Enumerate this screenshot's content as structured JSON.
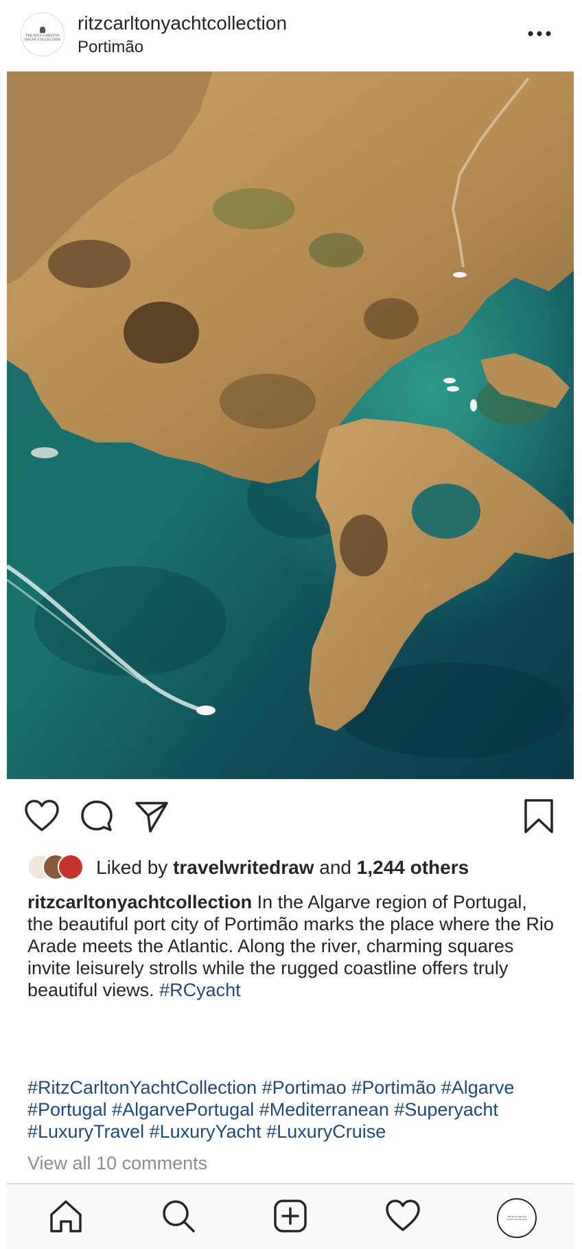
{
  "post": {
    "username": "ritzcarltonyachtcollection",
    "location": "Portimão",
    "likes": {
      "prefix": "Liked by",
      "liker": "travelwritedraw",
      "middle": "and",
      "count": "1,244 others"
    },
    "caption": {
      "author": "ritzcarltonyachtcollection",
      "text": "In the Algarve region of Portugal, the beautiful port city of Portimão marks the place where the Rio Arade meets the Atlantic. Along the river, charming squares invite leisurely strolls while the rugged coastline offers truly beautiful views.",
      "tag": "#RCyacht"
    },
    "hashtags": "#RitzCarltonYachtCollection #Portimao #Portimão #Algarve #Portugal #AlgarvePortugal #Mediterranean #Superyacht #LuxuryTravel #LuxuryYacht #LuxuryCruise",
    "comments_link": "View all 10 comments"
  },
  "logo": {
    "line1": "THE RITZ-CARLTON",
    "line2": "YACHT COLLECTION"
  },
  "icons": {
    "more": "more-horizontal-icon",
    "like": "heart-icon",
    "comment": "comment-icon",
    "share": "paper-plane-icon",
    "save": "bookmark-icon",
    "home": "home-icon",
    "search": "search-icon",
    "new_post": "plus-square-icon",
    "activity": "heart-icon",
    "profile": "profile-avatar"
  },
  "colors": {
    "hashtag": "#1f4a7a",
    "muted": "#8e8e8e",
    "text": "#262626"
  }
}
